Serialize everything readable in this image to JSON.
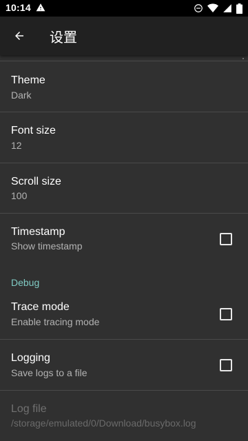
{
  "status_bar": {
    "time": "10:14",
    "icons": [
      "warning-icon",
      "do-not-disturb-icon",
      "wifi-icon",
      "cell-signal-icon",
      "battery-icon"
    ]
  },
  "app_bar": {
    "back_icon": "arrow-back-icon",
    "title": "设置"
  },
  "settings": {
    "theme": {
      "title": "Theme",
      "summary": "Dark"
    },
    "font_size": {
      "title": "Font size",
      "summary": "12"
    },
    "scroll_size": {
      "title": "Scroll size",
      "summary": "100"
    },
    "timestamp": {
      "title": "Timestamp",
      "summary": "Show timestamp",
      "checked": false
    },
    "debug_category": "Debug",
    "trace_mode": {
      "title": "Trace mode",
      "summary": "Enable tracing mode",
      "checked": false
    },
    "logging": {
      "title": "Logging",
      "summary": "Save logs to a file",
      "checked": false
    },
    "log_file": {
      "title": "Log file",
      "summary": "/storage/emulated/0/Download/busybox.log",
      "enabled": false
    }
  },
  "colors": {
    "background": "#303030",
    "app_bar": "#212121",
    "status_bar": "#000000",
    "accent": "#80cbc4",
    "divider": "#4a4a4a"
  }
}
